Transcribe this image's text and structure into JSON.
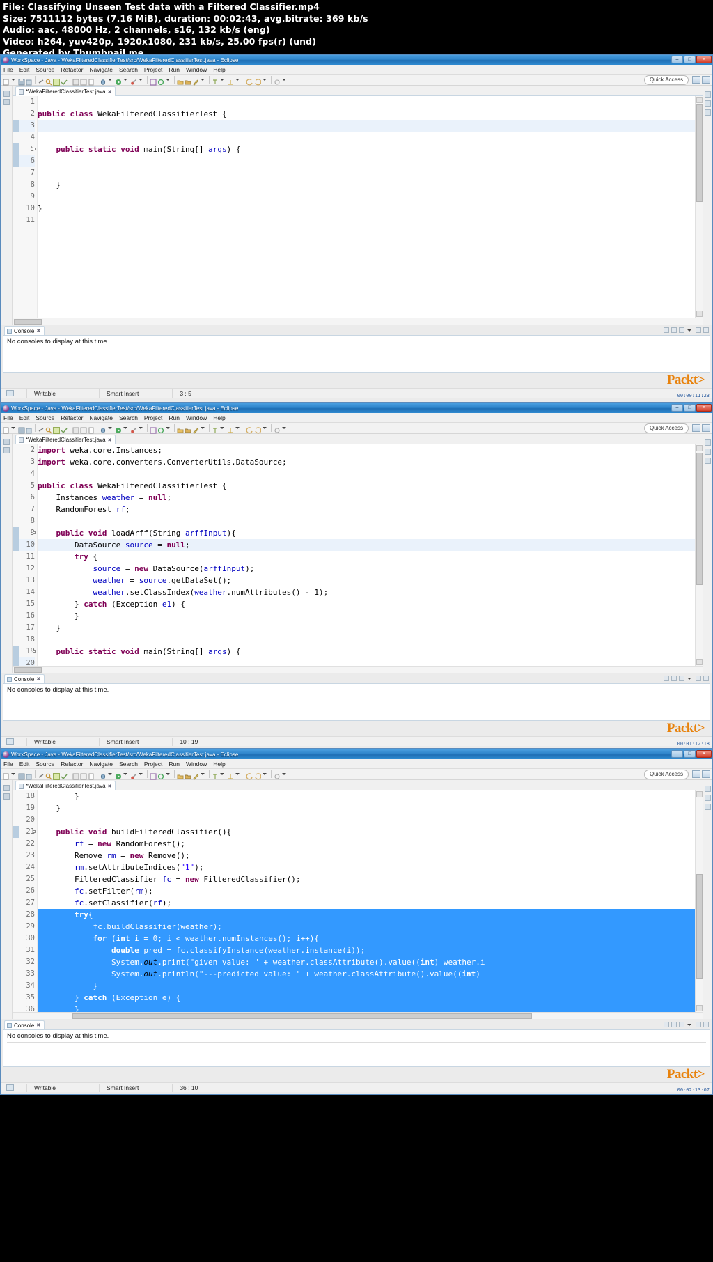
{
  "video_info": {
    "file_line": "File: Classifying Unseen Test data with a Filtered Classifier.mp4",
    "size_line": "Size: 7511112 bytes (7.16 MiB), duration: 00:02:43, avg.bitrate: 369 kb/s",
    "audio_line": "Audio: aac, 48000 Hz, 2 channels, s16, 132 kb/s (eng)",
    "video_line": "Video: h264, yuv420p, 1920x1080, 231 kb/s, 25.00 fps(r) (und)",
    "generated_line": "Generated by Thumbnail me"
  },
  "window_title": "WorkSpace - Java - WekaFilteredClassifierTest/src/WekaFilteredClassifierTest.java - Eclipse",
  "menu": [
    "File",
    "Edit",
    "Source",
    "Refactor",
    "Navigate",
    "Search",
    "Project",
    "Run",
    "Window",
    "Help"
  ],
  "window_buttons": {
    "minimize": "–",
    "maximize": "□",
    "close": "✕"
  },
  "quick_access": "Quick Access",
  "editor_tab": {
    "label": "*WekaFilteredClassifierTest.java",
    "close": "✖"
  },
  "console": {
    "tab_label": "Console",
    "empty_message": "No consoles to display at this time."
  },
  "watermark": "Packt>",
  "status": {
    "writable": "Writable",
    "insert_mode": "Smart Insert",
    "pos_1": "3 : 5",
    "pos_2": "10 : 19",
    "pos_3": "36 : 10"
  },
  "timestamps": {
    "shot1": "00:00:11:23",
    "shot2": "00:01:12:18",
    "shot3": "00:02:13:07"
  },
  "panes": [
    {
      "id": "pane-1",
      "first_line_no": 1,
      "lines": [
        {
          "n": 1,
          "code": "",
          "state": "normal"
        },
        {
          "n": 2,
          "code": "public class WekaFilteredClassifierTest {",
          "state": "normal"
        },
        {
          "n": 3,
          "code": "",
          "state": "current"
        },
        {
          "n": 4,
          "code": "",
          "state": "normal"
        },
        {
          "n": 5,
          "code": "    public static void main(String[] args) {",
          "state": "fold"
        },
        {
          "n": 6,
          "code": "",
          "state": "marked"
        },
        {
          "n": 7,
          "code": "",
          "state": "normal"
        },
        {
          "n": 8,
          "code": "    }",
          "state": "normal"
        },
        {
          "n": 9,
          "code": "",
          "state": "normal"
        },
        {
          "n": 10,
          "code": "}",
          "state": "normal"
        },
        {
          "n": 11,
          "code": "",
          "state": "normal"
        }
      ]
    },
    {
      "id": "pane-2",
      "first_line_no": 2,
      "lines": [
        {
          "n": 2,
          "code": "import weka.core.Instances;",
          "state": "normal"
        },
        {
          "n": 3,
          "code": "import weka.core.converters.ConverterUtils.DataSource;",
          "state": "normal"
        },
        {
          "n": 4,
          "code": "",
          "state": "normal"
        },
        {
          "n": 5,
          "code": "public class WekaFilteredClassifierTest {",
          "state": "normal"
        },
        {
          "n": 6,
          "code": "    Instances weather = null;",
          "state": "normal"
        },
        {
          "n": 7,
          "code": "    RandomForest rf;",
          "state": "normal"
        },
        {
          "n": 8,
          "code": "",
          "state": "normal"
        },
        {
          "n": 9,
          "code": "    public void loadArff(String arffInput){",
          "state": "fold"
        },
        {
          "n": 10,
          "code": "        DataSource source = null;",
          "state": "current"
        },
        {
          "n": 11,
          "code": "        try {",
          "state": "normal"
        },
        {
          "n": 12,
          "code": "            source = new DataSource(arffInput);",
          "state": "normal"
        },
        {
          "n": 13,
          "code": "            weather = source.getDataSet();",
          "state": "normal"
        },
        {
          "n": 14,
          "code": "            weather.setClassIndex(weather.numAttributes() - 1);",
          "state": "normal"
        },
        {
          "n": 15,
          "code": "        } catch (Exception e1) {",
          "state": "normal"
        },
        {
          "n": 16,
          "code": "        }",
          "state": "normal"
        },
        {
          "n": 17,
          "code": "    }",
          "state": "normal"
        },
        {
          "n": 18,
          "code": "",
          "state": "normal"
        },
        {
          "n": 19,
          "code": "    public static void main(String[] args) {",
          "state": "fold"
        },
        {
          "n": 20,
          "code": "",
          "state": "marked"
        }
      ]
    },
    {
      "id": "pane-3",
      "first_line_no": 18,
      "lines": [
        {
          "n": 18,
          "code": "        }",
          "state": "normal"
        },
        {
          "n": 19,
          "code": "    }",
          "state": "normal"
        },
        {
          "n": 20,
          "code": "",
          "state": "normal"
        },
        {
          "n": 21,
          "code": "    public void buildFilteredClassifier(){",
          "state": "fold"
        },
        {
          "n": 22,
          "code": "        rf = new RandomForest();",
          "state": "normal"
        },
        {
          "n": 23,
          "code": "        Remove rm = new Remove();",
          "state": "normal"
        },
        {
          "n": 24,
          "code": "        rm.setAttributeIndices(\"1\");",
          "state": "normal"
        },
        {
          "n": 25,
          "code": "        FilteredClassifier fc = new FilteredClassifier();",
          "state": "normal"
        },
        {
          "n": 26,
          "code": "        fc.setFilter(rm);",
          "state": "normal"
        },
        {
          "n": 27,
          "code": "        fc.setClassifier(rf);",
          "state": "normal"
        },
        {
          "n": 28,
          "code": "        try{",
          "state": "selected"
        },
        {
          "n": 29,
          "code": "            fc.buildClassifier(weather);",
          "state": "selected"
        },
        {
          "n": 30,
          "code": "            for (int i = 0; i < weather.numInstances(); i++){",
          "state": "selected"
        },
        {
          "n": 31,
          "code": "                double pred = fc.classifyInstance(weather.instance(i));",
          "state": "selected"
        },
        {
          "n": 32,
          "code": "                System.out.print(\"given value: \" + weather.classAttribute().value((int) weather.i",
          "state": "selected"
        },
        {
          "n": 33,
          "code": "                System.out.println(\"---predicted value: \" + weather.classAttribute().value((int)",
          "state": "selected"
        },
        {
          "n": 34,
          "code": "            }",
          "state": "selected"
        },
        {
          "n": 35,
          "code": "        } catch (Exception e) {",
          "state": "selected"
        },
        {
          "n": 36,
          "code": "        }",
          "state": "selected-last"
        }
      ]
    }
  ]
}
